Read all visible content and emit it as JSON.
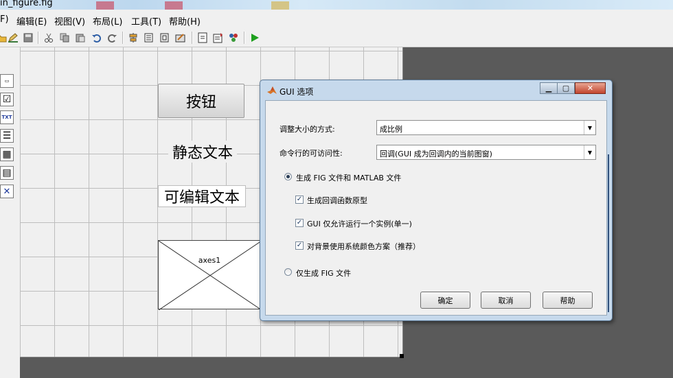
{
  "window": {
    "title": "in_figure.fig"
  },
  "menu": {
    "partial": "F)",
    "items": [
      "编辑(E)",
      "视图(V)",
      "布局(L)",
      "工具(T)",
      "帮助(H)"
    ]
  },
  "toolbar": {
    "icons": [
      "open-icon",
      "edit-icon",
      "save-icon",
      "cut-icon",
      "copy-icon",
      "paste-icon",
      "undo-icon",
      "redo-icon",
      "align-icon",
      "menu-editor-icon",
      "tab-order-icon",
      "toolbar-editor-icon",
      "mfile-icon",
      "property-inspector-icon",
      "object-browser-icon",
      "run-icon"
    ]
  },
  "palette": {
    "items": [
      {
        "name": "slider-tool",
        "glyph": "▭"
      },
      {
        "name": "checkbox-tool",
        "glyph": "☑"
      },
      {
        "name": "text-tool",
        "glyph": "TXT"
      },
      {
        "name": "listbox-tool",
        "glyph": "☰"
      },
      {
        "name": "table-tool",
        "glyph": "▦"
      },
      {
        "name": "panel-tool",
        "glyph": "▤"
      },
      {
        "name": "activex-tool",
        "glyph": "✕"
      }
    ]
  },
  "canvas": {
    "button_label": "按钮",
    "static_label": "静态文本",
    "edit_label": "可编辑文本",
    "axes_label": "axes1"
  },
  "dialog": {
    "title": "GUI 选项",
    "resize_label": "调整大小的方式:",
    "resize_value": "成比例",
    "access_label": "命令行的可访问性:",
    "access_value": "回调(GUI 成为回调内的当前图窗)",
    "radio_fig_and_m": "生成 FIG 文件和 MATLAB 文件",
    "check_callbacks": "生成回调函数原型",
    "check_single": "GUI 仅允许运行一个实例(单一)",
    "check_colors": "对背景使用系统颜色方案（推荐）",
    "radio_fig_only": "仅生成 FIG 文件",
    "ok": "确定",
    "cancel": "取消",
    "help": "帮助"
  }
}
